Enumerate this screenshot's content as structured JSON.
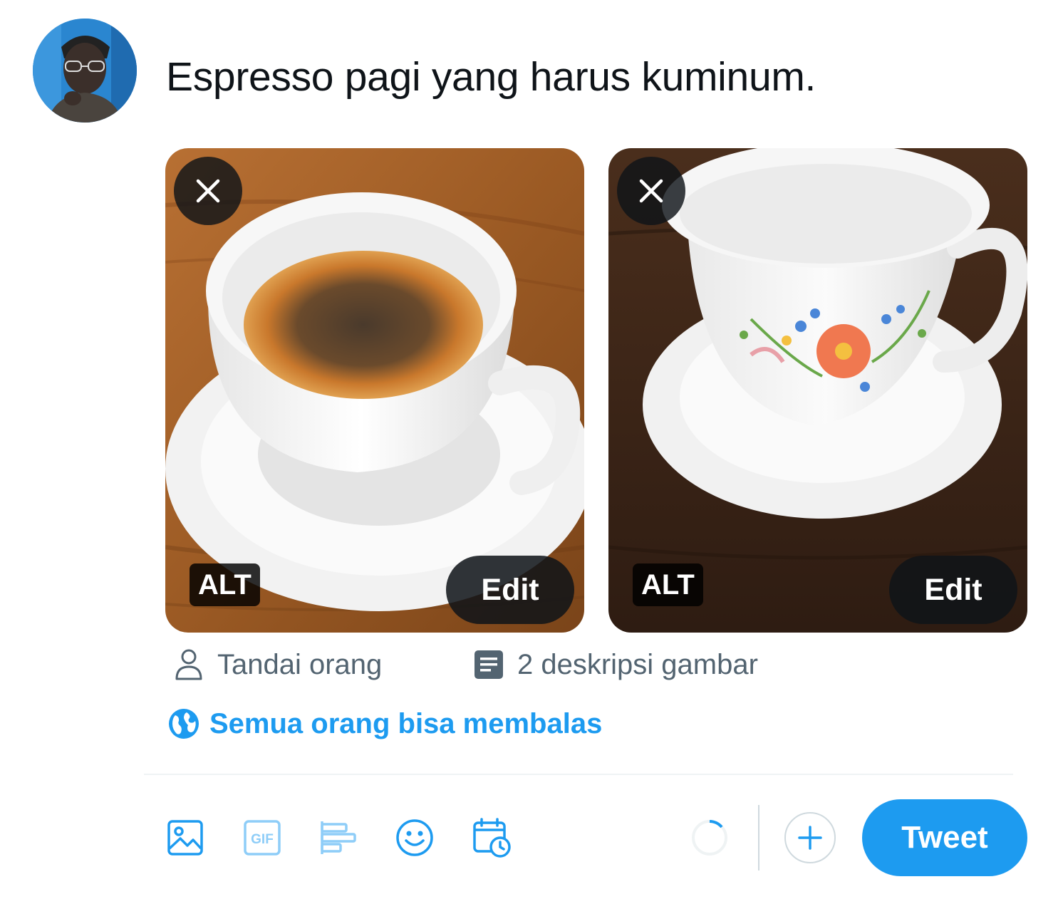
{
  "composer": {
    "avatar_alt": "",
    "text": "Espresso pagi yang harus kuminum."
  },
  "media": [
    {
      "alt_label": "ALT",
      "edit_label": "Edit",
      "remove_icon": "close-icon"
    },
    {
      "alt_label": "ALT",
      "edit_label": "Edit",
      "remove_icon": "close-icon"
    }
  ],
  "media_actions": {
    "tag_people": "Tandai orang",
    "image_descriptions": "2 deskripsi gambar"
  },
  "reply_setting": {
    "label": "Semua orang bisa membalas",
    "icon": "globe-icon"
  },
  "toolbar": {
    "icons": [
      "image-icon",
      "gif-icon",
      "poll-icon",
      "emoji-icon",
      "schedule-icon"
    ],
    "gif_text": "GIF",
    "tweet_label": "Tweet"
  },
  "colors": {
    "accent": "#1d9bf0",
    "secondary_text": "#536471",
    "primary_text": "#0f1419",
    "divider": "#eff3f4"
  }
}
